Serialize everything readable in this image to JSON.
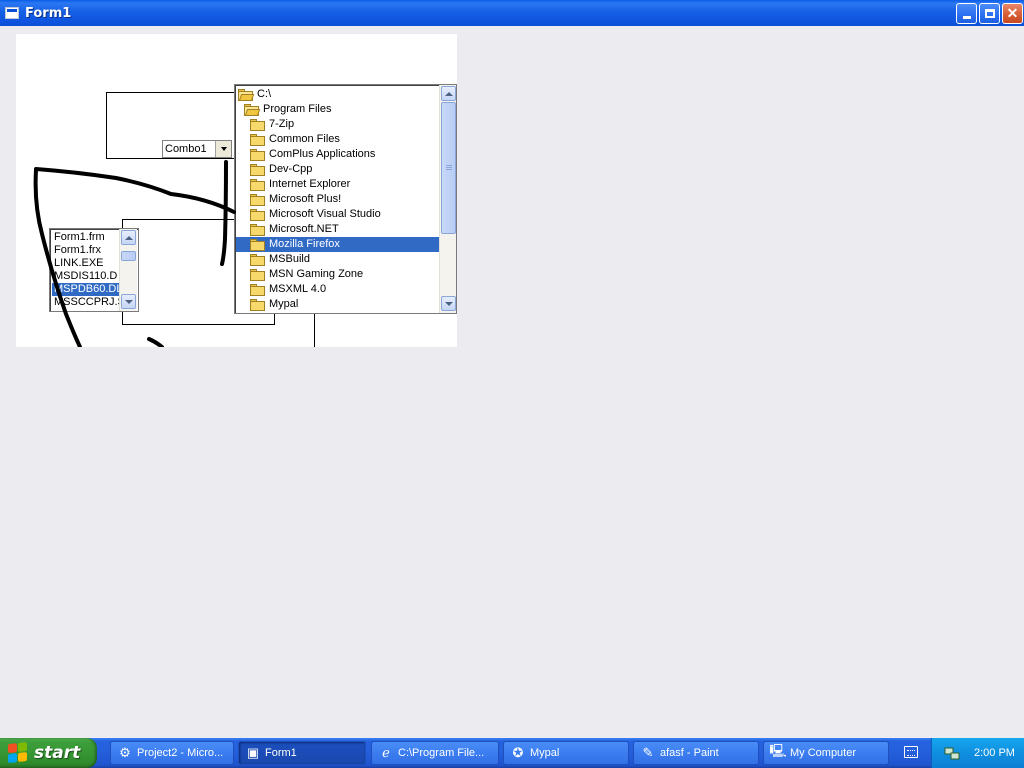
{
  "window": {
    "title": "Form1",
    "icon": "form-window-icon"
  },
  "form": {
    "combo": {
      "value": "Combo1"
    },
    "file_list": {
      "items": [
        "Form1.frm",
        "Form1.frx",
        "LINK.EXE",
        "MSDIS110.D",
        "MSPDB60.DL",
        "MSSCCPRJ.S"
      ],
      "selected_index": 4
    },
    "dir_list": {
      "items": [
        {
          "label": "C:\\",
          "state": "open",
          "indent": 0
        },
        {
          "label": "Program Files",
          "state": "open",
          "indent": 1
        },
        {
          "label": "7-Zip",
          "state": "closed",
          "indent": 2
        },
        {
          "label": "Common Files",
          "state": "closed",
          "indent": 2
        },
        {
          "label": "ComPlus Applications",
          "state": "closed",
          "indent": 2
        },
        {
          "label": "Dev-Cpp",
          "state": "closed",
          "indent": 2
        },
        {
          "label": "Internet Explorer",
          "state": "closed",
          "indent": 2
        },
        {
          "label": "Microsoft Plus!",
          "state": "closed",
          "indent": 2
        },
        {
          "label": "Microsoft Visual Studio",
          "state": "closed",
          "indent": 2
        },
        {
          "label": "Microsoft.NET",
          "state": "closed",
          "indent": 2
        },
        {
          "label": "Mozilla Firefox",
          "state": "closed",
          "indent": 2
        },
        {
          "label": "MSBuild",
          "state": "closed",
          "indent": 2
        },
        {
          "label": "MSN Gaming Zone",
          "state": "closed",
          "indent": 2
        },
        {
          "label": "MSXML 4.0",
          "state": "closed",
          "indent": 2
        },
        {
          "label": "Mypal",
          "state": "closed",
          "indent": 2
        }
      ],
      "selected_index": 10
    }
  },
  "taskbar": {
    "start_label": "start",
    "tasks": [
      {
        "label": "Project2 - Micro...",
        "icon": "vb6-icon",
        "active": false
      },
      {
        "label": "Form1",
        "icon": "form-window-icon",
        "active": true
      },
      {
        "label": "C:\\Program File...",
        "icon": "internet-explorer-icon",
        "active": false
      },
      {
        "label": "Mypal",
        "icon": "mypal-icon",
        "active": false
      },
      {
        "label": "afasf - Paint",
        "icon": "paint-icon",
        "active": false
      },
      {
        "label": "My Computer",
        "icon": "my-computer-icon",
        "active": false
      }
    ],
    "clock": "2:00 PM"
  },
  "colors": {
    "titlebar": "#0b4fd6",
    "selection": "#316ac5",
    "desktop_bg": "#ecebf0",
    "start_green": "#379734",
    "tray_blue": "#0f8fe0"
  }
}
